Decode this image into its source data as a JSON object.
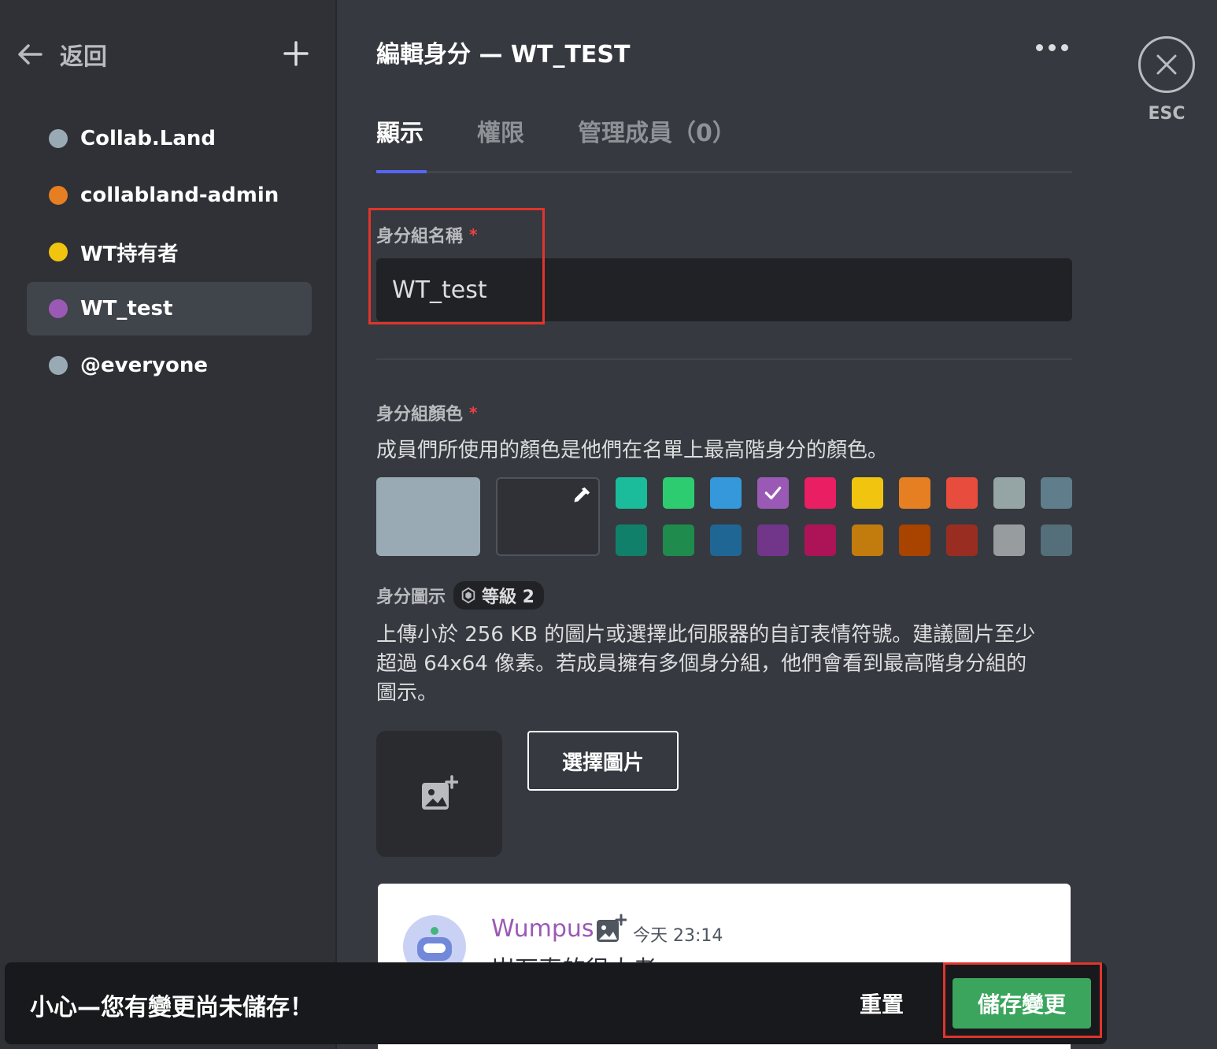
{
  "sidebar": {
    "back_label": "返回",
    "roles": [
      {
        "name": "Collab.Land",
        "color": "#99aab5"
      },
      {
        "name": "collabland-admin",
        "color": "#e67e22"
      },
      {
        "name": "WT持有者",
        "color": "#f1c40f"
      },
      {
        "name": "WT_test",
        "color": "#9b59b6",
        "active": true
      },
      {
        "name": "@everyone",
        "color": "#99aab5"
      }
    ]
  },
  "header": {
    "title": "編輯身分 — WT_TEST",
    "tabs": [
      {
        "label": "顯示",
        "active": true
      },
      {
        "label": "權限"
      },
      {
        "label": "管理成員（0）"
      }
    ]
  },
  "role_name": {
    "label": "身分組名稱",
    "required_mark": "*",
    "value": "WT_test"
  },
  "role_color": {
    "label": "身分組顏色",
    "required_mark": "*",
    "description": "成員們所使用的顏色是他們在名單上最高階身分的顏色。",
    "default_color": "#99aab5",
    "selected_color": "#9b59b6",
    "swatches_row1": [
      "#1abc9c",
      "#2ecc71",
      "#3498db",
      "#9b59b6",
      "#e91e63",
      "#f1c40f",
      "#e67e22",
      "#e74c3c",
      "#95a5a6",
      "#607d8b"
    ],
    "swatches_row2": [
      "#11806a",
      "#1f8b4c",
      "#206694",
      "#71368a",
      "#ad1457",
      "#c27c0e",
      "#a84300",
      "#992d22",
      "#979c9f",
      "#546e7a"
    ]
  },
  "role_icon": {
    "label": "身分圖示",
    "badge": "等級 2",
    "description_lines": [
      "上傳小於 256 KB 的圖片或選擇此伺服器的自訂表情符號。建議圖片至少",
      "超過 64x64 像素。若成員擁有多個身分組，他們會看到最高階身分組的",
      "圖示。"
    ],
    "choose_button": "選擇圖片"
  },
  "preview": {
    "username": "Wumpus",
    "time": "今天 23:14",
    "message": "岩石真的很大者"
  },
  "close": {
    "label": "ESC"
  },
  "notice": {
    "text": "小心—您有變更尚未儲存！",
    "reset": "重置",
    "save": "儲存變更"
  }
}
